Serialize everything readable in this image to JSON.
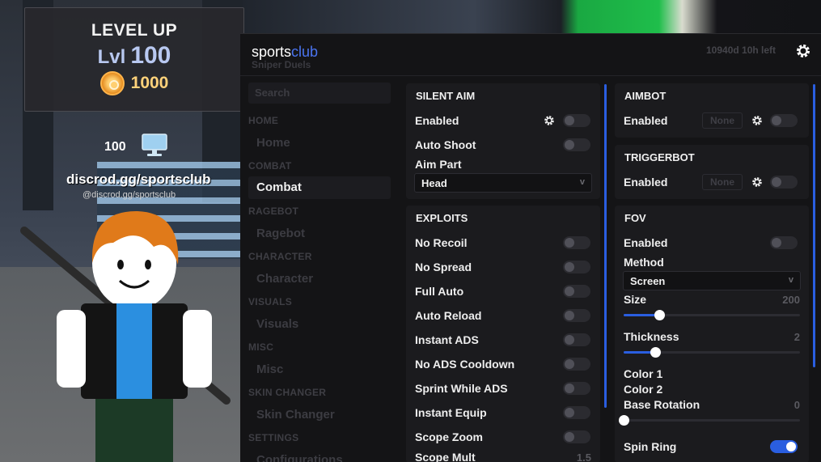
{
  "hud": {
    "level_title": "LEVEL UP",
    "level_prefix": "Lvl",
    "level_value": "100",
    "coins": "1000"
  },
  "player": {
    "count": "100",
    "discord": "discrod.gg/sportsclub",
    "handle": "@discrod.gg/sportsclub"
  },
  "menu": {
    "brand_main": "sports",
    "brand_accent": "club",
    "subtitle": "Sniper Duels",
    "license": "10940d 10h left",
    "accent_color": "#2a5ee0"
  },
  "sidebar": {
    "search_placeholder": "Search",
    "sections": [
      {
        "title": "HOME",
        "item": "Home"
      },
      {
        "title": "COMBAT",
        "item": "Combat"
      },
      {
        "title": "RAGEBOT",
        "item": "Ragebot"
      },
      {
        "title": "CHARACTER",
        "item": "Character"
      },
      {
        "title": "VISUALS",
        "item": "Visuals"
      },
      {
        "title": "MISC",
        "item": "Misc"
      },
      {
        "title": "SKIN CHANGER",
        "item": "Skin Changer"
      },
      {
        "title": "SETTINGS",
        "item": "Configurations"
      }
    ],
    "active": "Combat"
  },
  "silent_aim": {
    "title": "SILENT AIM",
    "enabled_label": "Enabled",
    "enabled": false,
    "auto_shoot_label": "Auto Shoot",
    "auto_shoot": false,
    "aim_part_label": "Aim Part",
    "aim_part_value": "Head",
    "chevron": "v"
  },
  "exploits": {
    "title": "EXPLOITS",
    "items": [
      {
        "label": "No Recoil",
        "on": false
      },
      {
        "label": "No Spread",
        "on": false
      },
      {
        "label": "Full Auto",
        "on": false
      },
      {
        "label": "Auto Reload",
        "on": false
      },
      {
        "label": "Instant ADS",
        "on": false
      },
      {
        "label": "No ADS Cooldown",
        "on": false
      },
      {
        "label": "Sprint While ADS",
        "on": false
      },
      {
        "label": "Instant Equip",
        "on": false
      },
      {
        "label": "Scope Zoom",
        "on": false
      }
    ],
    "scope_mult_label": "Scope Mult",
    "scope_mult_value": "1.5"
  },
  "aimbot": {
    "title": "AIMBOT",
    "enabled_label": "Enabled",
    "key": "None",
    "enabled": false
  },
  "triggerbot": {
    "title": "TRIGGERBOT",
    "enabled_label": "Enabled",
    "key": "None",
    "enabled": false
  },
  "fov": {
    "title": "FOV",
    "enabled_label": "Enabled",
    "enabled": false,
    "method_label": "Method",
    "method_value": "Screen",
    "chevron": "v",
    "size_label": "Size",
    "size_value": "200",
    "size_fraction": 0.2,
    "thickness_label": "Thickness",
    "thickness_value": "2",
    "thickness_fraction": 0.18,
    "color1_label": "Color 1",
    "color2_label": "Color 2",
    "base_rotation_label": "Base Rotation",
    "base_rotation_value": "0",
    "base_rotation_fraction": 0.0,
    "spin_ring_label": "Spin Ring",
    "spin_ring": true
  }
}
